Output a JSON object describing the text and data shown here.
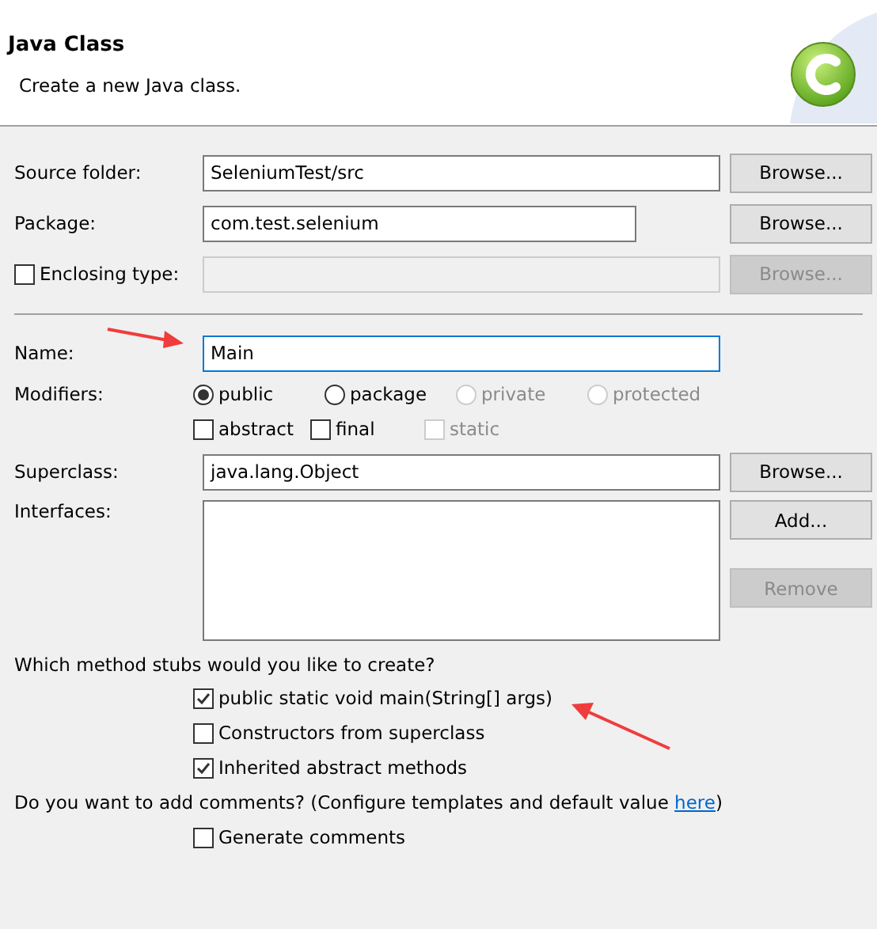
{
  "header": {
    "title": "Java Class",
    "description": "Create a new Java class."
  },
  "source_folder": {
    "label": "Source folder:",
    "value": "SeleniumTest/src",
    "button": {
      "label": "Browse...",
      "disabled": false
    }
  },
  "package": {
    "label": "Package:",
    "value": "com.test.selenium",
    "button": {
      "label": "Browse...",
      "disabled": false
    }
  },
  "enclosing_type": {
    "label": "Enclosing type:",
    "checked": false,
    "disabled": true,
    "button": {
      "label": "Browse...",
      "disabled": true
    }
  },
  "name": {
    "label": "Name:",
    "value": "Main",
    "focused": true
  },
  "modifiers": {
    "label": "Modifiers:",
    "access": [
      {
        "label": "public",
        "selected": true,
        "disabled": false
      },
      {
        "label": "package",
        "selected": false,
        "disabled": false
      },
      {
        "label": "private",
        "selected": false,
        "disabled": true
      },
      {
        "label": "protected",
        "selected": false,
        "disabled": true
      }
    ],
    "other": [
      {
        "label": "abstract",
        "checked": false,
        "disabled": false
      },
      {
        "label": "final",
        "checked": false,
        "disabled": false
      },
      {
        "label": "static",
        "checked": false,
        "disabled": true
      }
    ]
  },
  "superclass": {
    "label": "Superclass:",
    "value": "java.lang.Object",
    "button": {
      "label": "Browse...",
      "disabled": false
    }
  },
  "interfaces": {
    "label": "Interfaces:",
    "buttons": [
      {
        "label": "Add...",
        "disabled": false
      },
      {
        "label": "Remove",
        "disabled": true
      }
    ]
  },
  "method_stubs": {
    "question": "Which method stubs would you like to create?",
    "options": [
      {
        "label": "public static void main(String[] args)",
        "checked": true
      },
      {
        "label": "Constructors from superclass",
        "checked": false
      },
      {
        "label": "Inherited abstract methods",
        "checked": true
      }
    ]
  },
  "comments": {
    "text_before": "Do you want to add comments? (Configure templates and default value ",
    "link": "here",
    "text_after": ")",
    "options": [
      {
        "label": "Generate comments",
        "checked": false
      }
    ]
  }
}
